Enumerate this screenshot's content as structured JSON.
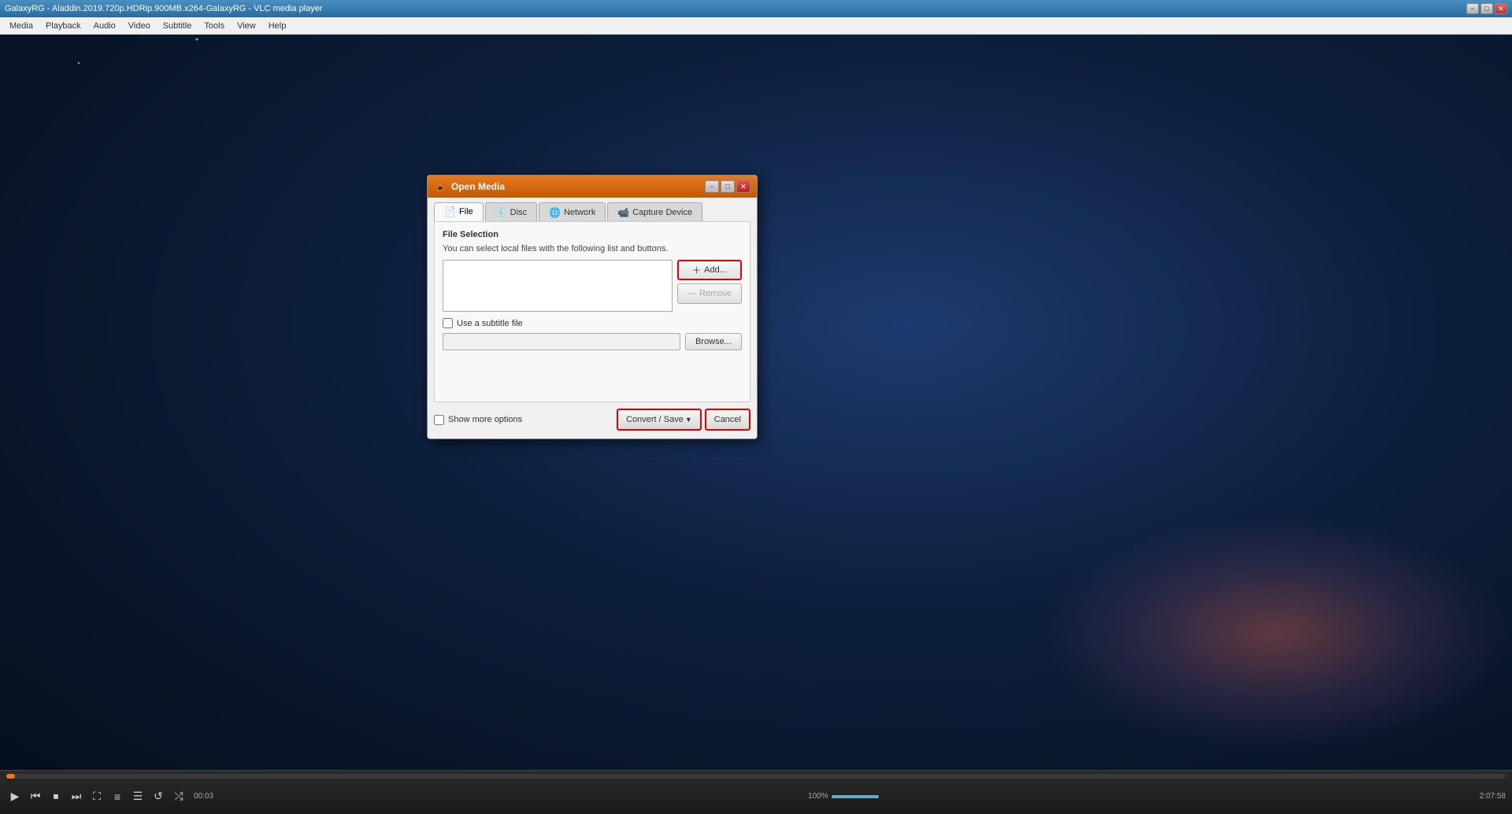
{
  "window": {
    "title": "GalaxyRG - Aladdin.2019.720p.HDRip.900MB.x264-GalaxyRG - VLC media player",
    "min_label": "−",
    "max_label": "□",
    "close_label": "✕"
  },
  "menubar": {
    "items": [
      "Media",
      "Playback",
      "Audio",
      "Video",
      "Subtitle",
      "Tools",
      "View",
      "Help"
    ]
  },
  "dialog": {
    "title": "Open Media",
    "min_label": "−",
    "max_label": "□",
    "close_label": "✕",
    "tabs": [
      {
        "id": "file",
        "label": "File",
        "icon": "📄",
        "active": true
      },
      {
        "id": "disc",
        "label": "Disc",
        "icon": "💿",
        "active": false
      },
      {
        "id": "network",
        "label": "Network",
        "icon": "🌐",
        "active": false
      },
      {
        "id": "capture",
        "label": "Capture Device",
        "icon": "📹",
        "active": false
      }
    ],
    "file_tab": {
      "section_title": "File Selection",
      "description": "You can select local files with the following list and buttons.",
      "add_button": "+ Add...",
      "remove_button": "— Remove",
      "subtitle_checkbox_label": "Use a subtitle file",
      "subtitle_placeholder": "",
      "browse_button": "Browse..."
    },
    "bottom": {
      "show_more_label": "Show more options",
      "convert_save_label": "Convert / Save",
      "dropdown_arrow": "▼",
      "cancel_label": "Cancel"
    }
  },
  "bottombar": {
    "time_current": "00:03",
    "time_total": "2:07:58",
    "volume_percent": "100%"
  }
}
